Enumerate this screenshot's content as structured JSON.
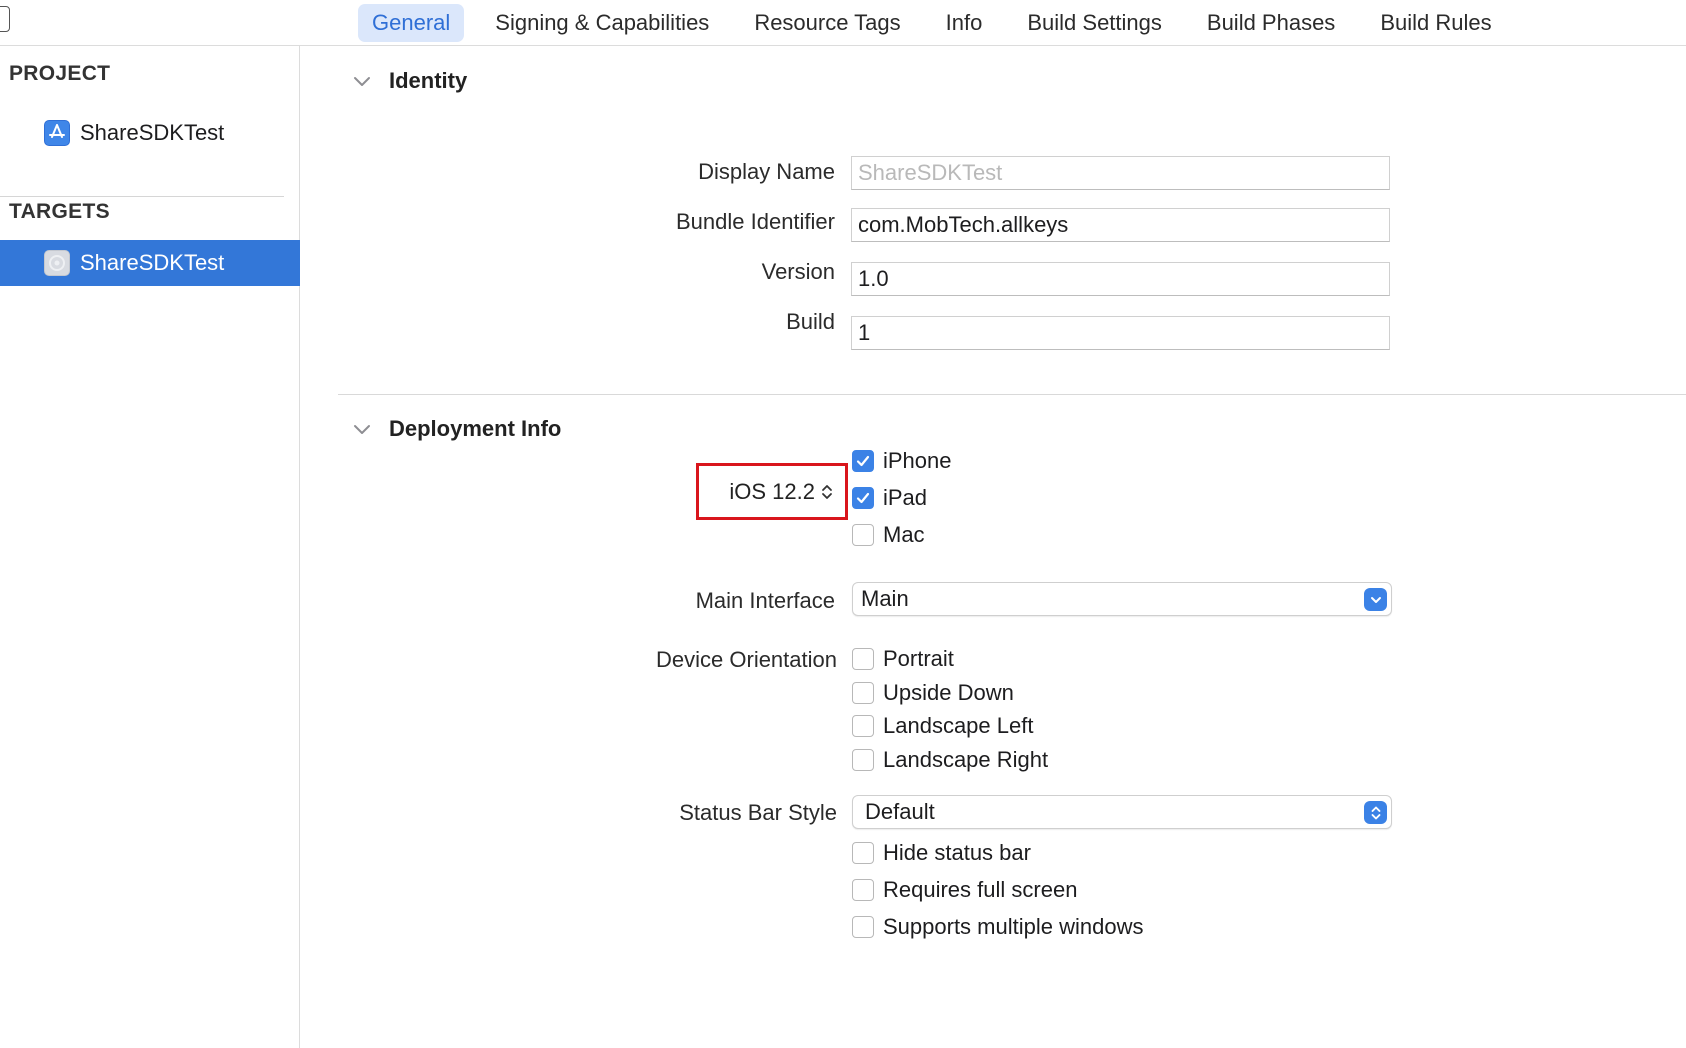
{
  "tabs": [
    {
      "label": "General",
      "active": true
    },
    {
      "label": "Signing & Capabilities",
      "active": false
    },
    {
      "label": "Resource Tags",
      "active": false
    },
    {
      "label": "Info",
      "active": false
    },
    {
      "label": "Build Settings",
      "active": false
    },
    {
      "label": "Build Phases",
      "active": false
    },
    {
      "label": "Build Rules",
      "active": false
    }
  ],
  "sidebar": {
    "project_header": "PROJECT",
    "project_item": "ShareSDKTest",
    "targets_header": "TARGETS",
    "target_item": "ShareSDKTest"
  },
  "identity": {
    "title": "Identity",
    "display_name_label": "Display Name",
    "display_name_placeholder": "ShareSDKTest",
    "bundle_id_label": "Bundle Identifier",
    "bundle_id_value": "com.MobTech.allkeys",
    "version_label": "Version",
    "version_value": "1.0",
    "build_label": "Build",
    "build_value": "1"
  },
  "deployment": {
    "title": "Deployment Info",
    "ios_version": "iOS 12.2",
    "devices": [
      {
        "label": "iPhone",
        "checked": true
      },
      {
        "label": "iPad",
        "checked": true
      },
      {
        "label": "Mac",
        "checked": false
      }
    ],
    "main_interface_label": "Main Interface",
    "main_interface_value": "Main",
    "device_orientation_label": "Device Orientation",
    "orientations": [
      {
        "label": "Portrait",
        "checked": false
      },
      {
        "label": "Upside Down",
        "checked": false
      },
      {
        "label": "Landscape Left",
        "checked": false
      },
      {
        "label": "Landscape Right",
        "checked": false
      }
    ],
    "status_bar_style_label": "Status Bar Style",
    "status_bar_style_value": "Default",
    "status_options": [
      {
        "label": "Hide status bar",
        "checked": false
      },
      {
        "label": "Requires full screen",
        "checked": false
      },
      {
        "label": "Supports multiple windows",
        "checked": false
      }
    ]
  },
  "colors": {
    "accent": "#3b82e6",
    "selection": "#3377d8",
    "highlight_box": "#d9151c",
    "active_tab_bg": "#dbe7fb"
  },
  "icons": {
    "project": "app-store-icon",
    "target": "app-icon",
    "disclosure": "chevron-down-icon",
    "popup": "chevron-updown-icon"
  }
}
